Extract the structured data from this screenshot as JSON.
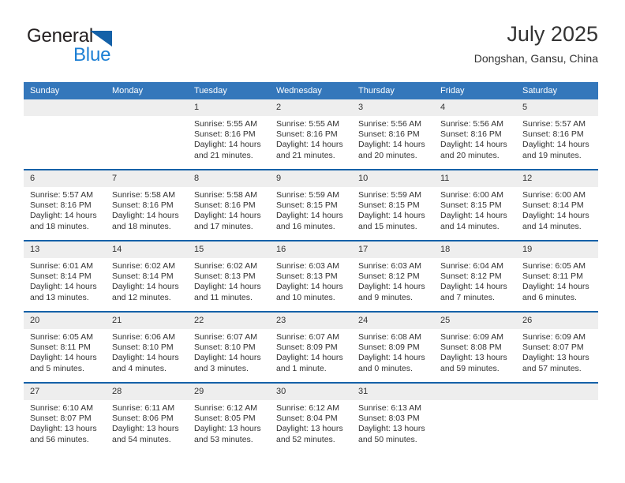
{
  "brand": {
    "name_top": "General",
    "name_bottom": "Blue",
    "accent_color": "#1c7fd4",
    "triangle_color": "#1461a8"
  },
  "header": {
    "title": "July 2025",
    "subtitle": "Dongshan, Gansu, China"
  },
  "theme": {
    "header_row_bg": "#3477bb",
    "row_divider": "#1461a8",
    "daynum_bg": "#eeeeee",
    "text": "#333333"
  },
  "weekdays": [
    "Sunday",
    "Monday",
    "Tuesday",
    "Wednesday",
    "Thursday",
    "Friday",
    "Saturday"
  ],
  "weeks": [
    [
      {
        "day": "",
        "sunrise": "",
        "sunset": "",
        "daylight1": "",
        "daylight2": ""
      },
      {
        "day": "",
        "sunrise": "",
        "sunset": "",
        "daylight1": "",
        "daylight2": ""
      },
      {
        "day": "1",
        "sunrise": "Sunrise: 5:55 AM",
        "sunset": "Sunset: 8:16 PM",
        "daylight1": "Daylight: 14 hours",
        "daylight2": "and 21 minutes."
      },
      {
        "day": "2",
        "sunrise": "Sunrise: 5:55 AM",
        "sunset": "Sunset: 8:16 PM",
        "daylight1": "Daylight: 14 hours",
        "daylight2": "and 21 minutes."
      },
      {
        "day": "3",
        "sunrise": "Sunrise: 5:56 AM",
        "sunset": "Sunset: 8:16 PM",
        "daylight1": "Daylight: 14 hours",
        "daylight2": "and 20 minutes."
      },
      {
        "day": "4",
        "sunrise": "Sunrise: 5:56 AM",
        "sunset": "Sunset: 8:16 PM",
        "daylight1": "Daylight: 14 hours",
        "daylight2": "and 20 minutes."
      },
      {
        "day": "5",
        "sunrise": "Sunrise: 5:57 AM",
        "sunset": "Sunset: 8:16 PM",
        "daylight1": "Daylight: 14 hours",
        "daylight2": "and 19 minutes."
      }
    ],
    [
      {
        "day": "6",
        "sunrise": "Sunrise: 5:57 AM",
        "sunset": "Sunset: 8:16 PM",
        "daylight1": "Daylight: 14 hours",
        "daylight2": "and 18 minutes."
      },
      {
        "day": "7",
        "sunrise": "Sunrise: 5:58 AM",
        "sunset": "Sunset: 8:16 PM",
        "daylight1": "Daylight: 14 hours",
        "daylight2": "and 18 minutes."
      },
      {
        "day": "8",
        "sunrise": "Sunrise: 5:58 AM",
        "sunset": "Sunset: 8:16 PM",
        "daylight1": "Daylight: 14 hours",
        "daylight2": "and 17 minutes."
      },
      {
        "day": "9",
        "sunrise": "Sunrise: 5:59 AM",
        "sunset": "Sunset: 8:15 PM",
        "daylight1": "Daylight: 14 hours",
        "daylight2": "and 16 minutes."
      },
      {
        "day": "10",
        "sunrise": "Sunrise: 5:59 AM",
        "sunset": "Sunset: 8:15 PM",
        "daylight1": "Daylight: 14 hours",
        "daylight2": "and 15 minutes."
      },
      {
        "day": "11",
        "sunrise": "Sunrise: 6:00 AM",
        "sunset": "Sunset: 8:15 PM",
        "daylight1": "Daylight: 14 hours",
        "daylight2": "and 14 minutes."
      },
      {
        "day": "12",
        "sunrise": "Sunrise: 6:00 AM",
        "sunset": "Sunset: 8:14 PM",
        "daylight1": "Daylight: 14 hours",
        "daylight2": "and 14 minutes."
      }
    ],
    [
      {
        "day": "13",
        "sunrise": "Sunrise: 6:01 AM",
        "sunset": "Sunset: 8:14 PM",
        "daylight1": "Daylight: 14 hours",
        "daylight2": "and 13 minutes."
      },
      {
        "day": "14",
        "sunrise": "Sunrise: 6:02 AM",
        "sunset": "Sunset: 8:14 PM",
        "daylight1": "Daylight: 14 hours",
        "daylight2": "and 12 minutes."
      },
      {
        "day": "15",
        "sunrise": "Sunrise: 6:02 AM",
        "sunset": "Sunset: 8:13 PM",
        "daylight1": "Daylight: 14 hours",
        "daylight2": "and 11 minutes."
      },
      {
        "day": "16",
        "sunrise": "Sunrise: 6:03 AM",
        "sunset": "Sunset: 8:13 PM",
        "daylight1": "Daylight: 14 hours",
        "daylight2": "and 10 minutes."
      },
      {
        "day": "17",
        "sunrise": "Sunrise: 6:03 AM",
        "sunset": "Sunset: 8:12 PM",
        "daylight1": "Daylight: 14 hours",
        "daylight2": "and 9 minutes."
      },
      {
        "day": "18",
        "sunrise": "Sunrise: 6:04 AM",
        "sunset": "Sunset: 8:12 PM",
        "daylight1": "Daylight: 14 hours",
        "daylight2": "and 7 minutes."
      },
      {
        "day": "19",
        "sunrise": "Sunrise: 6:05 AM",
        "sunset": "Sunset: 8:11 PM",
        "daylight1": "Daylight: 14 hours",
        "daylight2": "and 6 minutes."
      }
    ],
    [
      {
        "day": "20",
        "sunrise": "Sunrise: 6:05 AM",
        "sunset": "Sunset: 8:11 PM",
        "daylight1": "Daylight: 14 hours",
        "daylight2": "and 5 minutes."
      },
      {
        "day": "21",
        "sunrise": "Sunrise: 6:06 AM",
        "sunset": "Sunset: 8:10 PM",
        "daylight1": "Daylight: 14 hours",
        "daylight2": "and 4 minutes."
      },
      {
        "day": "22",
        "sunrise": "Sunrise: 6:07 AM",
        "sunset": "Sunset: 8:10 PM",
        "daylight1": "Daylight: 14 hours",
        "daylight2": "and 3 minutes."
      },
      {
        "day": "23",
        "sunrise": "Sunrise: 6:07 AM",
        "sunset": "Sunset: 8:09 PM",
        "daylight1": "Daylight: 14 hours",
        "daylight2": "and 1 minute."
      },
      {
        "day": "24",
        "sunrise": "Sunrise: 6:08 AM",
        "sunset": "Sunset: 8:09 PM",
        "daylight1": "Daylight: 14 hours",
        "daylight2": "and 0 minutes."
      },
      {
        "day": "25",
        "sunrise": "Sunrise: 6:09 AM",
        "sunset": "Sunset: 8:08 PM",
        "daylight1": "Daylight: 13 hours",
        "daylight2": "and 59 minutes."
      },
      {
        "day": "26",
        "sunrise": "Sunrise: 6:09 AM",
        "sunset": "Sunset: 8:07 PM",
        "daylight1": "Daylight: 13 hours",
        "daylight2": "and 57 minutes."
      }
    ],
    [
      {
        "day": "27",
        "sunrise": "Sunrise: 6:10 AM",
        "sunset": "Sunset: 8:07 PM",
        "daylight1": "Daylight: 13 hours",
        "daylight2": "and 56 minutes."
      },
      {
        "day": "28",
        "sunrise": "Sunrise: 6:11 AM",
        "sunset": "Sunset: 8:06 PM",
        "daylight1": "Daylight: 13 hours",
        "daylight2": "and 54 minutes."
      },
      {
        "day": "29",
        "sunrise": "Sunrise: 6:12 AM",
        "sunset": "Sunset: 8:05 PM",
        "daylight1": "Daylight: 13 hours",
        "daylight2": "and 53 minutes."
      },
      {
        "day": "30",
        "sunrise": "Sunrise: 6:12 AM",
        "sunset": "Sunset: 8:04 PM",
        "daylight1": "Daylight: 13 hours",
        "daylight2": "and 52 minutes."
      },
      {
        "day": "31",
        "sunrise": "Sunrise: 6:13 AM",
        "sunset": "Sunset: 8:03 PM",
        "daylight1": "Daylight: 13 hours",
        "daylight2": "and 50 minutes."
      },
      {
        "day": "",
        "sunrise": "",
        "sunset": "",
        "daylight1": "",
        "daylight2": ""
      },
      {
        "day": "",
        "sunrise": "",
        "sunset": "",
        "daylight1": "",
        "daylight2": ""
      }
    ]
  ]
}
